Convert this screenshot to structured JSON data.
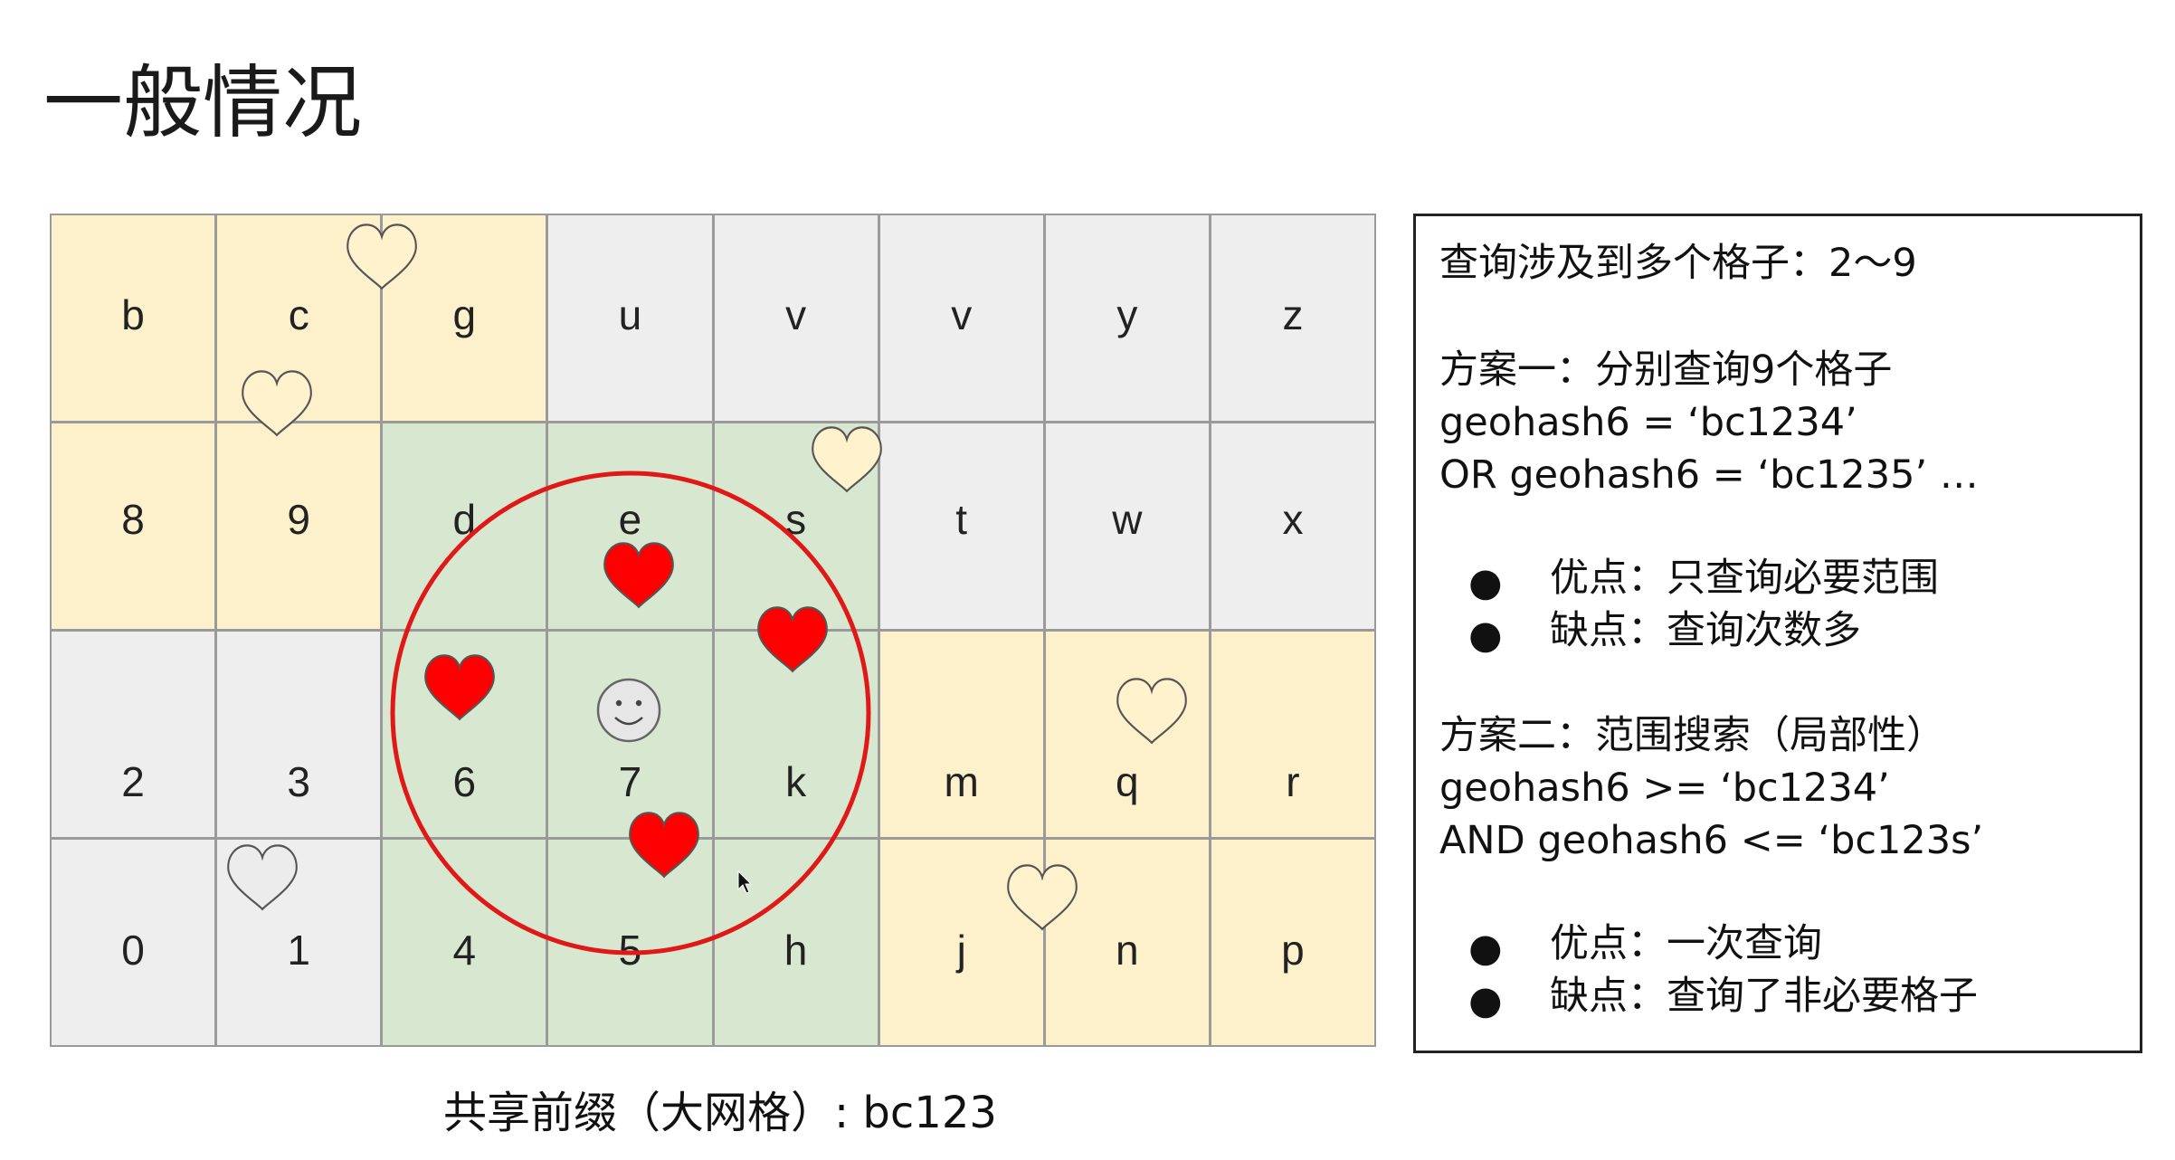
{
  "slide": {
    "title": "一般情况",
    "caption": "共享前缀（大网格）: bc123"
  },
  "grid": {
    "rows": [
      [
        "b",
        "c",
        "g",
        "u",
        "v",
        "v",
        "y",
        "z"
      ],
      [
        "8",
        "9",
        "d",
        "e",
        "s",
        "t",
        "w",
        "x"
      ],
      [
        "2",
        "3",
        "6",
        "7",
        "k",
        "m",
        "q",
        "r"
      ],
      [
        "0",
        "1",
        "4",
        "5",
        "h",
        "j",
        "n",
        "p"
      ]
    ],
    "colors": {
      "yellow": "#fdf1cc",
      "green": "#d7e7d0",
      "gray": "#eeeeee",
      "circle": "#e01818",
      "heart_red": "#ff0000",
      "heart_cream": "#fff2cc",
      "heart_gray": "#ececec"
    }
  },
  "panel": {
    "line1": "查询涉及到多个格子：2～9",
    "plan1_title": "方案一：分别查询9个格子",
    "plan1_code1": "geohash6 = ‘bc1234’",
    "plan1_code2": "OR geohash6 = ‘bc1235’ …",
    "plan1_pro": "优点：只查询必要范围",
    "plan1_con": "缺点：查询次数多",
    "plan2_title": "方案二：范围搜索（局部性）",
    "plan2_code1": "geohash6 >= ‘bc1234’",
    "plan2_code2": "AND geohash6 <= ‘bc123s’",
    "plan2_pro": "优点：一次查询",
    "plan2_con": "缺点：查询了非必要格子",
    "bullet": "●"
  }
}
